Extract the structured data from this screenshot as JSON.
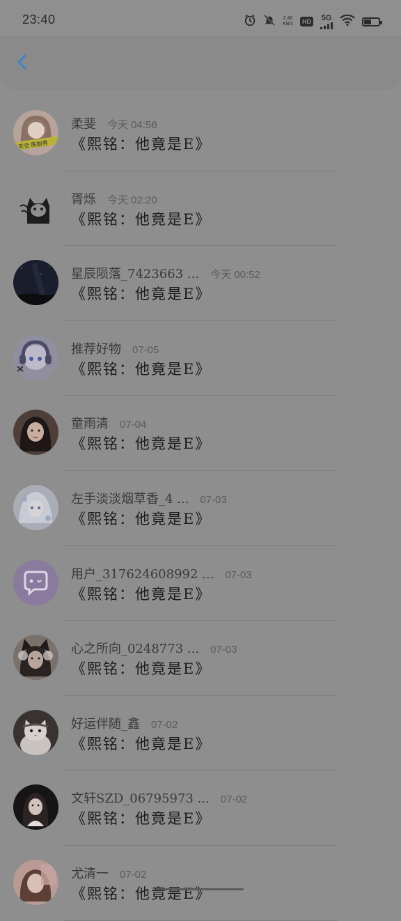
{
  "status_bar": {
    "time": "23:40",
    "net_speed_value": "2.40",
    "net_speed_unit": "KB/s",
    "hd_label": "HD",
    "network_label": "5G"
  },
  "header": {
    "back_icon": "chevron-left-icon",
    "accent_color": "#3a86c8"
  },
  "comments": [
    {
      "name": "柔斐",
      "time": "今天 04:56",
      "content": "《熙铭：他竟是E》",
      "avatar_style": "girl-portrait-yellow-banner",
      "avatar_text": "天空  陈韵秀"
    },
    {
      "name": "胥烁",
      "time": "今天 02:20",
      "content": "《熙铭：他竟是E》",
      "avatar_style": "cartoon-cat"
    },
    {
      "name": "星辰陨落_7423663 ...",
      "time": "今天 00:52",
      "content": "《熙铭：他竟是E》",
      "avatar_style": "night-sky"
    },
    {
      "name": "推荐好物",
      "time": "07-05",
      "content": "《熙铭：他竟是E》",
      "avatar_style": "anime-headphones"
    },
    {
      "name": "童雨清",
      "time": "07-04",
      "content": "《熙铭：他竟是E》",
      "avatar_style": "girl-dark-hair"
    },
    {
      "name": "左手淡淡烟草香_4 ...",
      "time": "07-03",
      "content": "《熙铭：他竟是E》",
      "avatar_style": "anime-pale"
    },
    {
      "name": "用户_317624608992 ...",
      "time": "07-03",
      "content": "《熙铭：他竟是E》",
      "avatar_style": "default-chat-purple"
    },
    {
      "name": "心之所向_0248773 ...",
      "time": "07-03",
      "content": "《熙铭：他竟是E》",
      "avatar_style": "girl-cat-ears"
    },
    {
      "name": "好运伴随_鑫",
      "time": "07-02",
      "content": "《熙铭：他竟是E》",
      "avatar_style": "cat-photo"
    },
    {
      "name": "文轩SZD_06795973 ...",
      "time": "07-02",
      "content": "《熙铭：他竟是E》",
      "avatar_style": "girl-dark-bg"
    },
    {
      "name": "尤清一",
      "time": "07-02",
      "content": "《熙铭：他竟是E》",
      "avatar_style": "girl-pink"
    }
  ]
}
